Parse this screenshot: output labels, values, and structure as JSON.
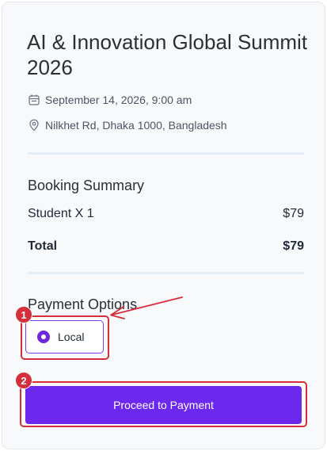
{
  "event": {
    "title": "AI & Innovation Global Summit 2026",
    "date": "September 14, 2026, 9:00 am",
    "location": "Nilkhet Rd, Dhaka 1000, Bangladesh"
  },
  "booking_summary": {
    "title": "Booking Summary",
    "items": [
      {
        "label": "Student X 1",
        "amount": "$79"
      }
    ],
    "total_label": "Total",
    "total_amount": "$79"
  },
  "payment_options": {
    "title": "Payment Options",
    "options": [
      {
        "label": "Local",
        "selected": true
      }
    ]
  },
  "actions": {
    "proceed_label": "Proceed to Payment"
  },
  "annotations": {
    "badge1": "1",
    "badge2": "2",
    "color": "#d42f3a"
  },
  "colors": {
    "accent": "#6d28ee",
    "divider": "#e3edf8",
    "card_bg": "#f7f9fb"
  },
  "icons": {
    "date": "calendar-icon",
    "location": "map-pin-icon"
  }
}
